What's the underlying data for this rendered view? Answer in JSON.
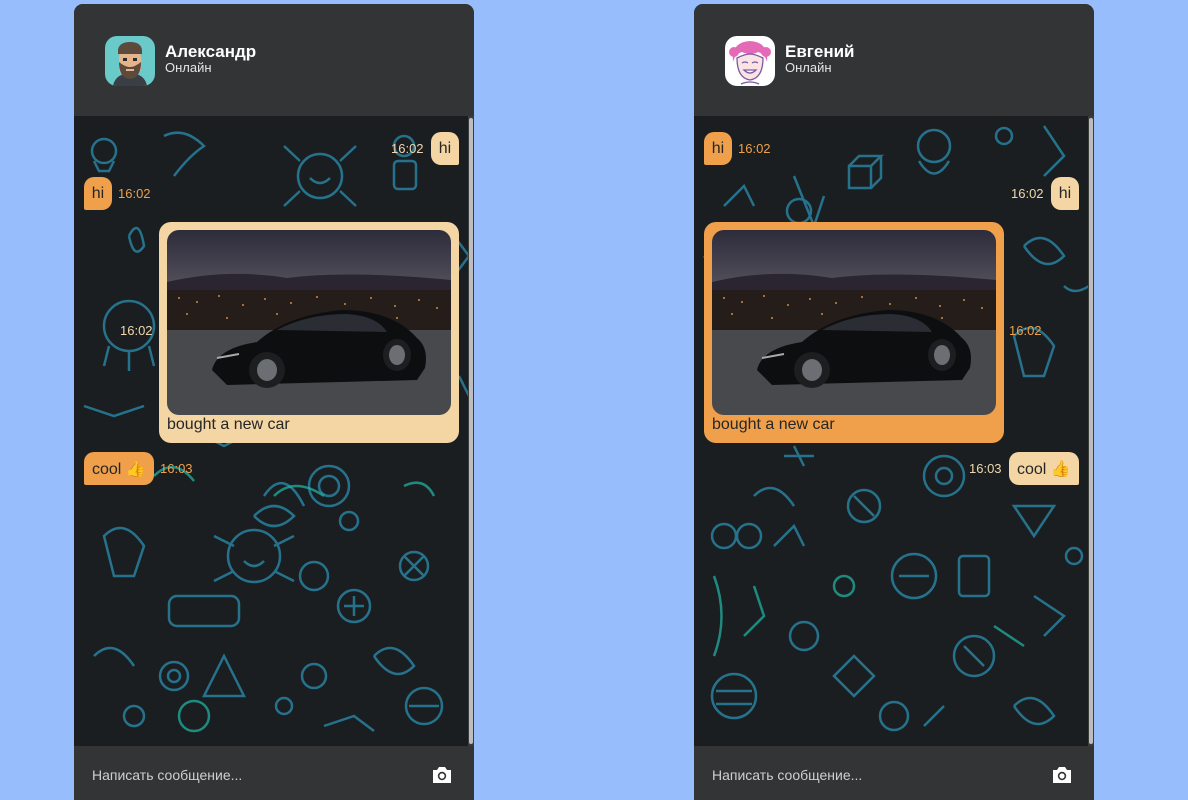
{
  "left": {
    "contact": {
      "name": "Александр",
      "status": "Онлайн"
    },
    "messages": [
      {
        "text": "hi",
        "time": "16:02"
      },
      {
        "text": "hi",
        "time": "16:02"
      },
      {
        "caption": "bought a new car",
        "time": "16:02"
      },
      {
        "text": "cool 👍",
        "time": "16:03"
      }
    ],
    "composer": {
      "placeholder": "Написать сообщение..."
    }
  },
  "right": {
    "contact": {
      "name": "Евгений",
      "status": "Онлайн"
    },
    "messages": [
      {
        "text": "hi",
        "time": "16:02"
      },
      {
        "text": "hi",
        "time": "16:02"
      },
      {
        "caption": "bought a new car",
        "time": "16:02"
      },
      {
        "text": "cool 👍",
        "time": "16:03"
      }
    ],
    "composer": {
      "placeholder": "Написать сообщение..."
    }
  },
  "icons": {
    "attach": "camera-icon"
  },
  "colors": {
    "page_bg": "#98bdfc",
    "incoming": "#f0a04b",
    "outgoing": "#f3d6a4",
    "header": "#333435"
  }
}
